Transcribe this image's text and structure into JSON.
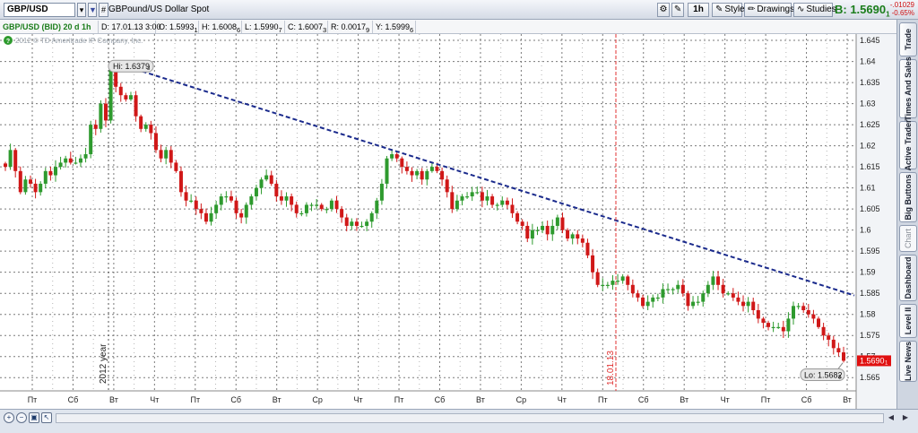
{
  "toolbar": {
    "symbol": "GBP/USD",
    "link_badge": "#",
    "description": "GBPound/US Dollar Spot",
    "timeframe_button": "1h",
    "style_button": "Style",
    "drawings_button": "Drawings",
    "studies_button": "Studies",
    "bid_label": "B: 1.5690",
    "bid_sub": "1",
    "change_abs": "-.01029",
    "change_pct": "-0.65%"
  },
  "infobar": {
    "title": "GBP/USD (BID) 20 d 1h",
    "date": "D: 17.01.13 3:00",
    "open": "O: 1.5993",
    "open_sub": "1",
    "high": "H: 1.6008",
    "high_sub": "6",
    "low": "L: 1.5990",
    "low_sub": "7",
    "close": "C: 1.6007",
    "close_sub": "3",
    "range": "R: 0.0017",
    "range_sub": "9",
    "y": "Y: 1.5999",
    "y_sub": "6"
  },
  "chart_data": {
    "type": "candlestick",
    "copyright": "2012 © TD Ameritrade IP Company, Inc.",
    "y_ticks": [
      "1.645",
      "1.64",
      "1.635",
      "1.63",
      "1.625",
      "1.62",
      "1.615",
      "1.61",
      "1.605",
      "1.6",
      "1.595",
      "1.59",
      "1.585",
      "1.58",
      "1.575",
      "1.57",
      "1.565"
    ],
    "ylim": [
      1.5625,
      1.6465
    ],
    "x_ticks": [
      "Пт",
      "Сб",
      "Вт",
      "Чт",
      "Пт",
      "Сб",
      "Вт",
      "Ср",
      "Чт",
      "Пт",
      "Сб",
      "Вт",
      "Ср",
      "Чт",
      "Пт",
      "Сб",
      "Вт",
      "Чт",
      "Пт",
      "Сб",
      "Вт"
    ],
    "year_marker": "2012 year",
    "date_marker": "18.01.13",
    "high_bubble": "Hi: 1.6379",
    "high_bubble_sub": "3",
    "low_bubble": "Lo: 1.5682",
    "low_bubble_sub": "3",
    "last_price": "1.5690",
    "last_price_sub": "1",
    "trendline": {
      "start": 1.6397,
      "end": 1.5845
    },
    "path": [
      1.615,
      1.619,
      1.614,
      1.609,
      1.612,
      1.611,
      1.609,
      1.611,
      1.614,
      1.613,
      1.615,
      1.616,
      1.617,
      1.616,
      1.616,
      1.617,
      1.618,
      1.625,
      1.624,
      1.63,
      1.626,
      1.638,
      1.634,
      1.632,
      1.631,
      1.632,
      1.627,
      1.624,
      1.625,
      1.623,
      1.619,
      1.617,
      1.619,
      1.616,
      1.614,
      1.609,
      1.607,
      1.607,
      1.605,
      1.604,
      1.602,
      1.604,
      1.606,
      1.608,
      1.608,
      1.607,
      1.604,
      1.603,
      1.606,
      1.608,
      1.61,
      1.612,
      1.613,
      1.611,
      1.608,
      1.607,
      1.608,
      1.606,
      1.604,
      1.604,
      1.606,
      1.606,
      1.606,
      1.605,
      1.605,
      1.607,
      1.605,
      1.603,
      1.601,
      1.602,
      1.601,
      1.601,
      1.602,
      1.604,
      1.607,
      1.611,
      1.617,
      1.618,
      1.617,
      1.615,
      1.614,
      1.613,
      1.614,
      1.612,
      1.614,
      1.615,
      1.614,
      1.612,
      1.609,
      1.605,
      1.607,
      1.608,
      1.608,
      1.609,
      1.609,
      1.607,
      1.608,
      1.606,
      1.606,
      1.607,
      1.606,
      1.604,
      1.602,
      1.601,
      1.598,
      1.6,
      1.6,
      1.601,
      1.599,
      1.601,
      1.603,
      1.6,
      1.598,
      1.599,
      1.598,
      1.597,
      1.594,
      1.59,
      1.587,
      1.587,
      1.587,
      1.588,
      1.588,
      1.589,
      1.587,
      1.585,
      1.584,
      1.582,
      1.583,
      1.584,
      1.584,
      1.586,
      1.586,
      1.586,
      1.587,
      1.585,
      1.582,
      1.583,
      1.583,
      1.585,
      1.587,
      1.589,
      1.587,
      1.585,
      1.585,
      1.584,
      1.583,
      1.582,
      1.583,
      1.581,
      1.579,
      1.578,
      1.577,
      1.577,
      1.577,
      1.576,
      1.579,
      1.582,
      1.582,
      1.581,
      1.58,
      1.579,
      1.577,
      1.575,
      1.574,
      1.572,
      1.571,
      1.569
    ]
  },
  "sidetabs": [
    "Trade",
    "Times And Sales",
    "Active Trader",
    "Big Buttons",
    "Chart",
    "Dashboard",
    "Level II",
    "Live News"
  ],
  "sidetabs_active": "Chart",
  "colors": {
    "up": "#2e9a2e",
    "down": "#d01818",
    "trend": "#1a2a8c",
    "date_line": "#e03030",
    "grid": "#7a7a7a"
  },
  "icons": {
    "zoom_in": "zoom-in-icon",
    "zoom_out": "zoom-out-icon",
    "fit": "fit-icon",
    "cursor": "cursor-icon",
    "scroll_left": "scroll-left-icon",
    "scroll_right": "scroll-right-icon"
  }
}
